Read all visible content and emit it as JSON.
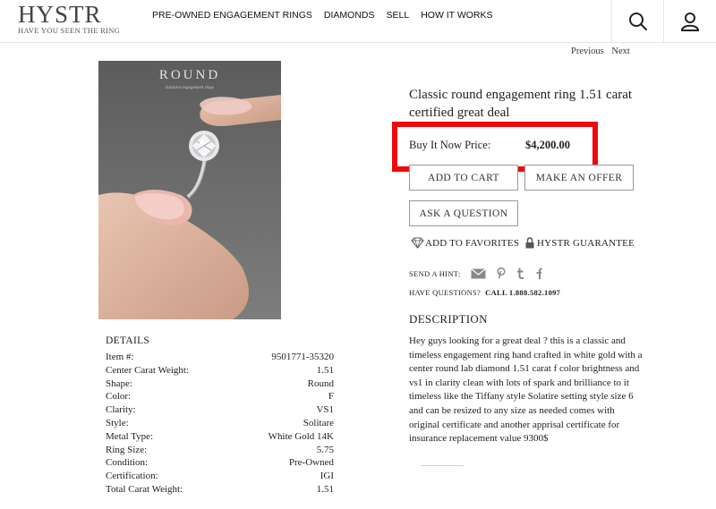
{
  "brand": {
    "name": "HYSTR",
    "tagline": "HAVE YOU SEEN THE RING"
  },
  "nav": [
    "PRE-OWNED ENGAGEMENT RINGS",
    "DIAMONDS",
    "SELL",
    "HOW IT WORKS"
  ],
  "header_icons": [
    "search-icon",
    "user-icon"
  ],
  "pager": {
    "previous": "Previous",
    "next": "Next"
  },
  "photo": {
    "brand": "ROUND",
    "subtitle": "Solitaire engagement rings"
  },
  "product": {
    "title": "Classic round engagement ring 1.51 carat certified great deal",
    "price_label": "Buy It Now Price:",
    "price": "$4,200.00"
  },
  "actions": {
    "add_to_cart": "ADD TO CART",
    "make_offer": "MAKE AN OFFER",
    "ask_question": "ASK A QUESTION",
    "add_favorites": "ADD TO FAVORITES",
    "guarantee": "HYSTR GUARANTEE"
  },
  "hint": {
    "label": "SEND A HINT:",
    "icons": [
      "mail-icon",
      "pinterest-icon",
      "tumblr-icon",
      "facebook-icon"
    ]
  },
  "questions": {
    "label": "HAVE QUESTIONS?",
    "phone": "CALL 1.888.582.1097"
  },
  "description": {
    "title": "DESCRIPTION",
    "text": "Hey guys looking for a great deal ? this is a classic and timeless engagement ring hand crafted in white gold with a center round lab diamond 1.51 carat f color brightness and vs1 in clarity clean with lots of spark and brilliance to it timeless like the Tiffany style Solatire setting style size 6 and can be resized to any size as needed comes with original certificate and another apprisal certificate for insurance replacement value 9300$"
  },
  "details": {
    "title": "DETAILS",
    "rows": [
      {
        "label": "Item #:",
        "value": "9501771-35320"
      },
      {
        "label": "Center Carat Weight:",
        "value": "1.51"
      },
      {
        "label": "Shape:",
        "value": "Round"
      },
      {
        "label": "Color:",
        "value": "F"
      },
      {
        "label": "Clarity:",
        "value": "VS1"
      },
      {
        "label": "Style:",
        "value": "Solitare"
      },
      {
        "label": "Metal Type:",
        "value": "White Gold 14K"
      },
      {
        "label": "Ring Size:",
        "value": "5.75"
      },
      {
        "label": "Condition:",
        "value": "Pre-Owned"
      },
      {
        "label": "Certification:",
        "value": "IGI"
      },
      {
        "label": "Total Carat Weight:",
        "value": "1.51"
      }
    ]
  },
  "colors": {
    "highlight_box": "#ee0a0a",
    "button_border": "#999999"
  }
}
